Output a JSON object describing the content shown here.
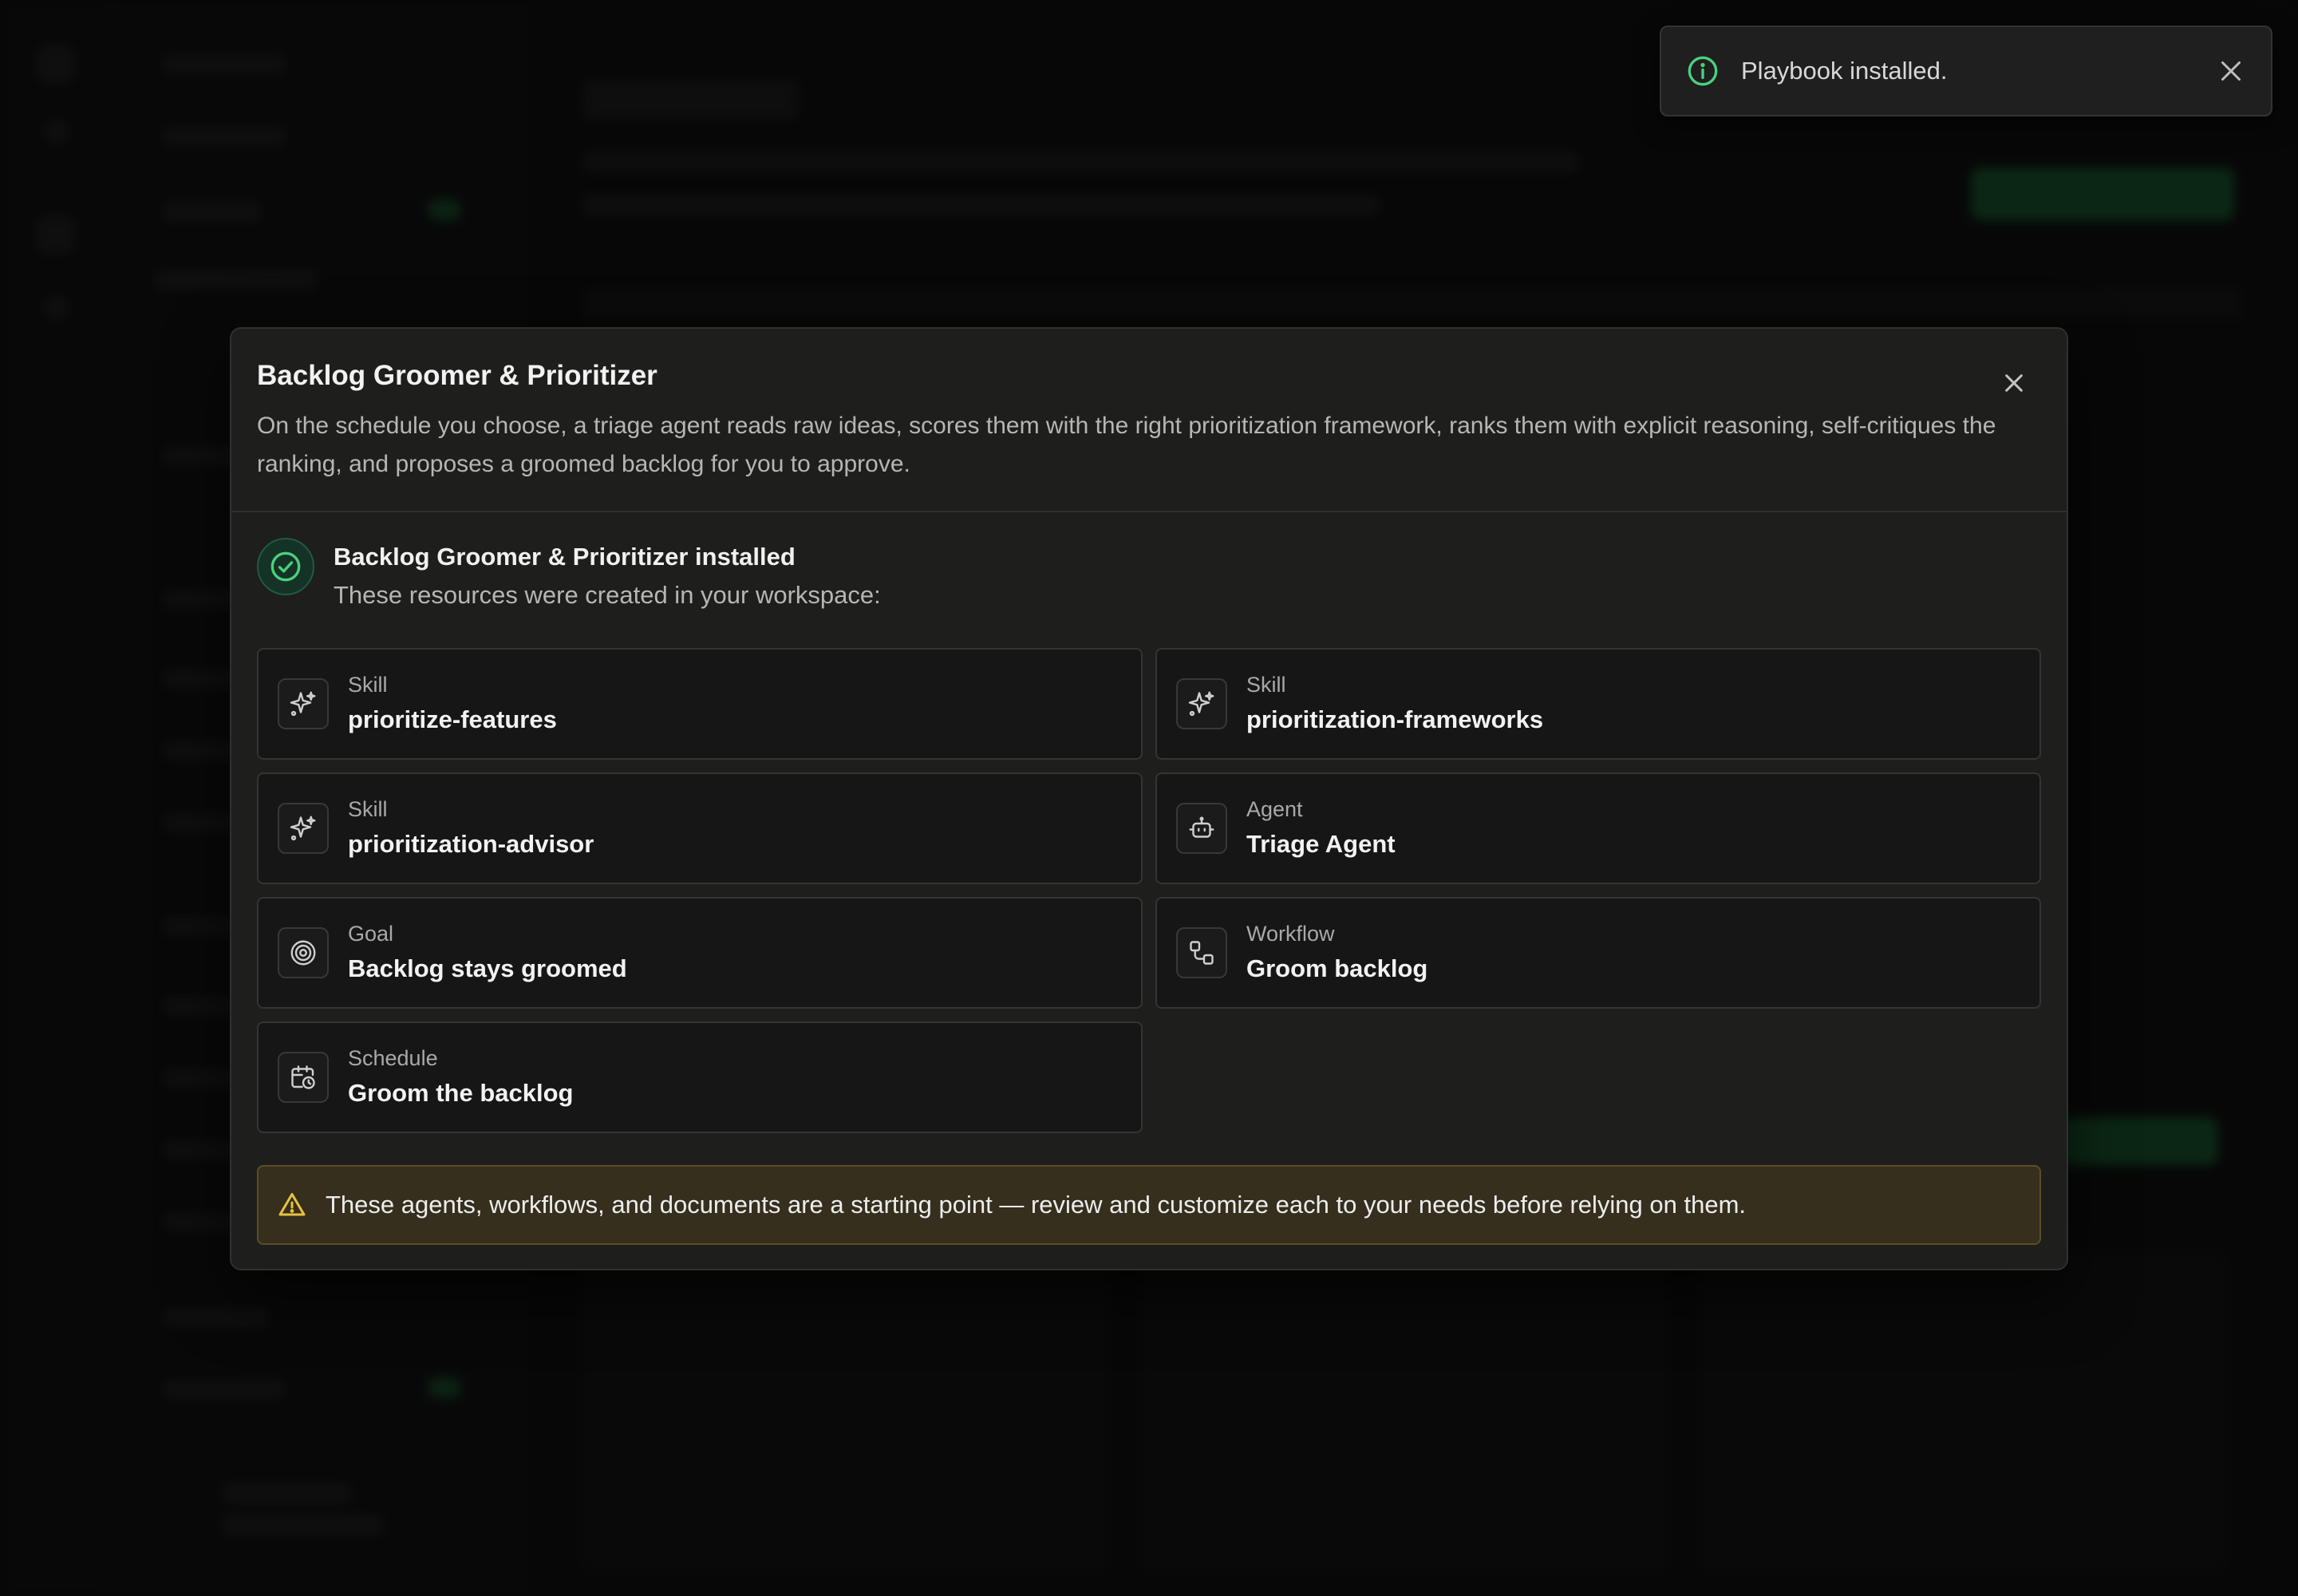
{
  "toast": {
    "message": "Playbook installed.",
    "icon": "info-circle-icon",
    "accent": "#4cd07d"
  },
  "modal": {
    "title": "Backlog Groomer & Prioritizer",
    "description": "On the schedule you choose, a triage agent reads raw ideas, scores them with the right prioritization framework, ranks them with explicit reasoning, self-critiques the ranking, and proposes a groomed backlog for you to approve.",
    "status": {
      "title": "Backlog Groomer & Prioritizer installed",
      "subtitle": "These resources were created in your workspace:"
    },
    "resources": [
      {
        "type": "Skill",
        "name": "prioritize-features",
        "icon": "sparkle-icon"
      },
      {
        "type": "Skill",
        "name": "prioritization-frameworks",
        "icon": "sparkle-icon"
      },
      {
        "type": "Skill",
        "name": "prioritization-advisor",
        "icon": "sparkle-icon"
      },
      {
        "type": "Agent",
        "name": "Triage Agent",
        "icon": "robot-icon"
      },
      {
        "type": "Goal",
        "name": "Backlog stays groomed",
        "icon": "target-icon"
      },
      {
        "type": "Workflow",
        "name": "Groom backlog",
        "icon": "workflow-icon"
      },
      {
        "type": "Schedule",
        "name": "Groom the backlog",
        "icon": "calendar-clock-icon"
      }
    ],
    "warning": "These agents, workflows, and documents are a starting point — review and customize each to your needs before relying on them.",
    "colors": {
      "success": "#4cd07d",
      "warning": "#e6c340",
      "warning_bg": "#362f1e"
    }
  }
}
